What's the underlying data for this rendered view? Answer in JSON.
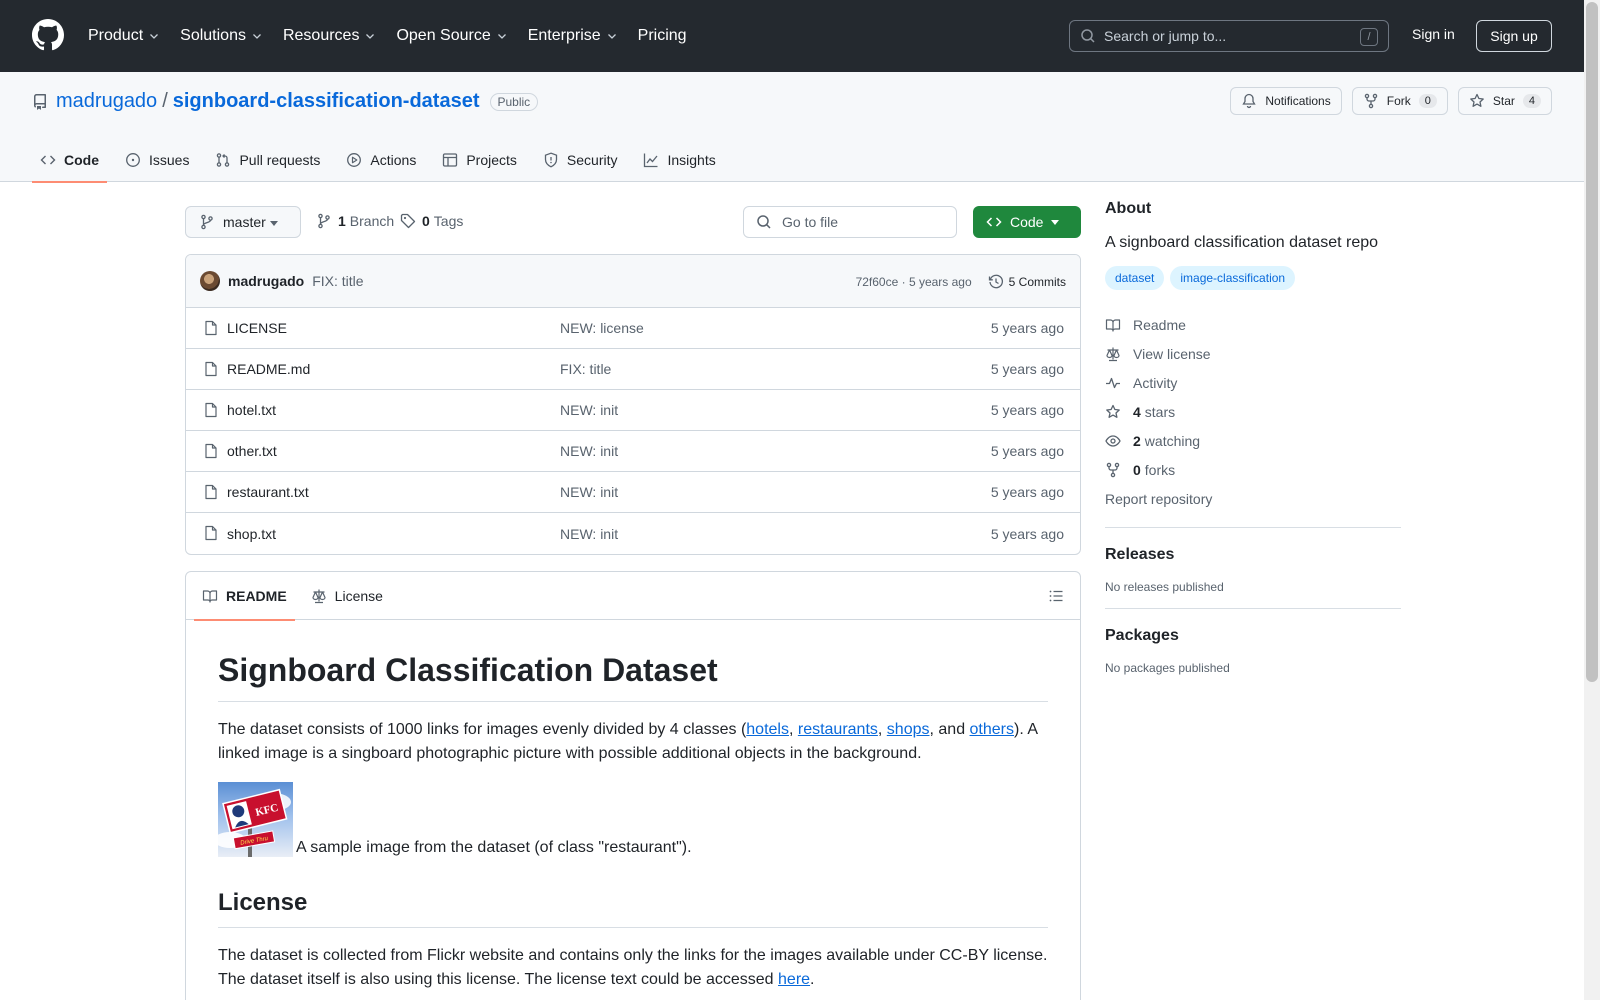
{
  "header": {
    "nav": [
      "Product",
      "Solutions",
      "Resources",
      "Open Source",
      "Enterprise",
      "Pricing"
    ],
    "search_placeholder": "Search or jump to...",
    "search_shortcut": "/",
    "sign_in": "Sign in",
    "sign_up": "Sign up"
  },
  "repo": {
    "owner": "madrugado",
    "separator": "/",
    "name": "signboard-classification-dataset",
    "visibility": "Public",
    "notifications_label": "Notifications",
    "fork_label": "Fork",
    "fork_count": "0",
    "star_label": "Star",
    "star_count": "4",
    "tabs": [
      "Code",
      "Issues",
      "Pull requests",
      "Actions",
      "Projects",
      "Security",
      "Insights"
    ]
  },
  "toolbar": {
    "branch": "master",
    "branch_count": "1",
    "branch_label": "Branch",
    "tag_count": "0",
    "tag_label": "Tags",
    "goto_placeholder": "Go to file",
    "code_label": "Code"
  },
  "commit": {
    "author": "madrugado",
    "message": "FIX: title",
    "hash_time": "72f60ce · 5 years ago",
    "commits_label": "5 Commits"
  },
  "files": [
    {
      "name": "LICENSE",
      "message": "NEW: license",
      "age": "5 years ago"
    },
    {
      "name": "README.md",
      "message": "FIX: title",
      "age": "5 years ago"
    },
    {
      "name": "hotel.txt",
      "message": "NEW: init",
      "age": "5 years ago"
    },
    {
      "name": "other.txt",
      "message": "NEW: init",
      "age": "5 years ago"
    },
    {
      "name": "restaurant.txt",
      "message": "NEW: init",
      "age": "5 years ago"
    },
    {
      "name": "shop.txt",
      "message": "NEW: init",
      "age": "5 years ago"
    }
  ],
  "readme": {
    "tab_readme": "README",
    "tab_license": "License",
    "title": "Signboard Classification Dataset",
    "p1_a": "The dataset consists of 1000 links for images evenly divided by 4 classes (",
    "link_hotels": "hotels",
    "comma1": ", ",
    "link_restaurants": "restaurants",
    "comma2": ", ",
    "link_shops": "shops",
    "and": ", and ",
    "link_others": "others",
    "p1_b": "). A linked image is a singboard photographic picture with possible additional objects in the background.",
    "sample_caption": "A sample image from the dataset (of class \"restaurant\").",
    "sample_sign_text": "KFC",
    "sample_sign_sub": "Drive Thru",
    "license_heading": "License",
    "p2_a": "The dataset is collected from Flickr website and contains only the links for the images available under CC-BY license. The dataset itself is also using this license. The license text could be accessed ",
    "link_here": "here",
    "p2_b": "."
  },
  "sidebar": {
    "about_title": "About",
    "description": "A signboard classification dataset repo",
    "topics": [
      "dataset",
      "image-classification"
    ],
    "readme": "Readme",
    "license": "View license",
    "activity": "Activity",
    "stars_count": "4",
    "stars_label": "stars",
    "watching_count": "2",
    "watching_label": "watching",
    "forks_count": "0",
    "forks_label": "forks",
    "report": "Report repository",
    "releases_title": "Releases",
    "releases_text": "No releases published",
    "packages_title": "Packages",
    "packages_text": "No packages published"
  },
  "colors": {
    "header_bg": "#24292f",
    "link": "#0969da",
    "code_button": "#1f883d",
    "tab_underline": "#fd8c73"
  }
}
